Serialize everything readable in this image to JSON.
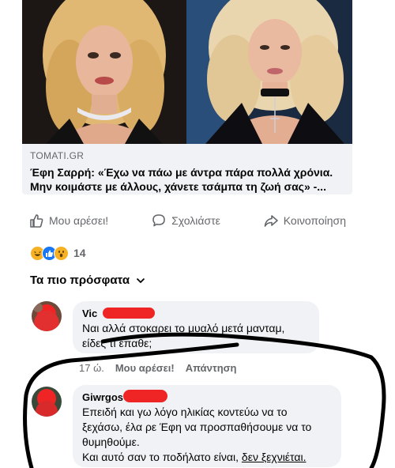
{
  "link_preview": {
    "source": "TOMATI.GR",
    "headline": "Έφη Σαρρή: «Έχω να πάω με άντρα πάρα πολλά χρόνια. Μην κοιμάστε με άλλους, χάνετε τσάμπα τη ζωή σας» -..."
  },
  "actions": {
    "like": "Μου αρέσει!",
    "comment": "Σχολιάστε",
    "share": "Κοινοποίηση"
  },
  "reactions": {
    "icons": [
      "haha-icon",
      "like-icon",
      "wow-icon"
    ],
    "count": "14"
  },
  "comments_sort": {
    "label": "Τα πιο πρόσφατα"
  },
  "comments": [
    {
      "name": "Vic",
      "text": "Ναι αλλά στοκαρει το μυαλό μετά μανταμ, είδες τι έπαθε;",
      "time": "17 ώ.",
      "like": "Μου αρέσει!",
      "reply": "Απάντηση"
    },
    {
      "name": "Giwrgos",
      "text_lines": [
        "Επειδή και γω λόγο ηλικίας κοντεύω να το",
        "ξεχάσω, έλα ρε Έφη να προσπαθήσουμε να το",
        "θυμηθούμε."
      ],
      "text_last_plain": "Και αυτό σαν το ποδήλατο είναι, ",
      "text_last_underlined": "δεν ξεχνιέται."
    }
  ],
  "colors": {
    "text_primary": "#050505",
    "text_secondary": "#65676b",
    "bubble_bg": "#f0f2f5",
    "redaction": "#ef2525",
    "marker": "#000000"
  }
}
